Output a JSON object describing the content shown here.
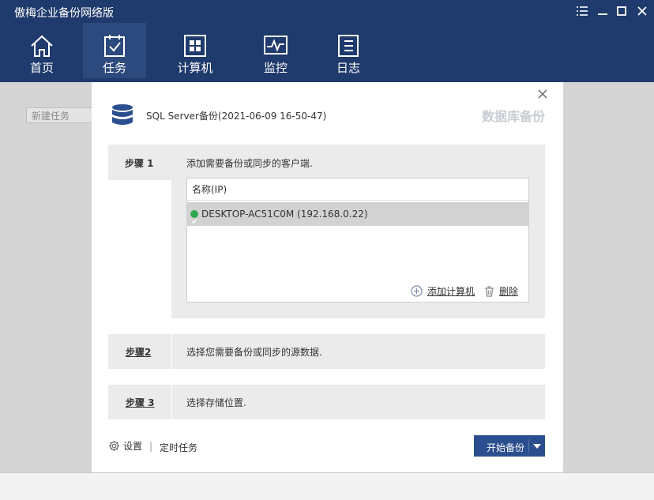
{
  "app": {
    "title": "傲梅企业备份网络版"
  },
  "window_controls": {
    "menu_icon": "menu-icon",
    "minimize_icon": "minimize-icon",
    "maximize_icon": "maximize-icon",
    "close_icon": "close-icon"
  },
  "nav": {
    "items": [
      {
        "label": "首页",
        "icon": "home-icon"
      },
      {
        "label": "任务",
        "icon": "task-icon",
        "active": true
      },
      {
        "label": "计算机",
        "icon": "computer-icon"
      },
      {
        "label": "监控",
        "icon": "monitor-icon"
      },
      {
        "label": "日志",
        "icon": "log-icon"
      }
    ]
  },
  "background": {
    "new_task_label": "新建任务"
  },
  "dialog": {
    "task_name": "SQL Server备份(2021-06-09 16-50-47)",
    "type_label": "数据库备份",
    "step1": {
      "label": "步骤 1",
      "description": "添加需要备份或同步的客户端.",
      "table_header": "名称(IP)",
      "clients": [
        {
          "name": "DESKTOP-AC51C0M (192.168.0.22)",
          "status": "online"
        }
      ],
      "add_computer_label": "添加计算机",
      "delete_label": "删除"
    },
    "step2": {
      "label": "步骤2",
      "description": "选择您需要备份或同步的源数据."
    },
    "step3": {
      "label": "步骤 3",
      "description": "选择存储位置."
    },
    "footer": {
      "settings_label": "设置",
      "separator": "|",
      "schedule_label": "定时任务",
      "start_label": "开始备份"
    }
  },
  "colors": {
    "header": "#1f3a6c",
    "active_tab": "#2c4a7d",
    "primary_button": "#2b4f8e",
    "status_online": "#2fa84f"
  }
}
